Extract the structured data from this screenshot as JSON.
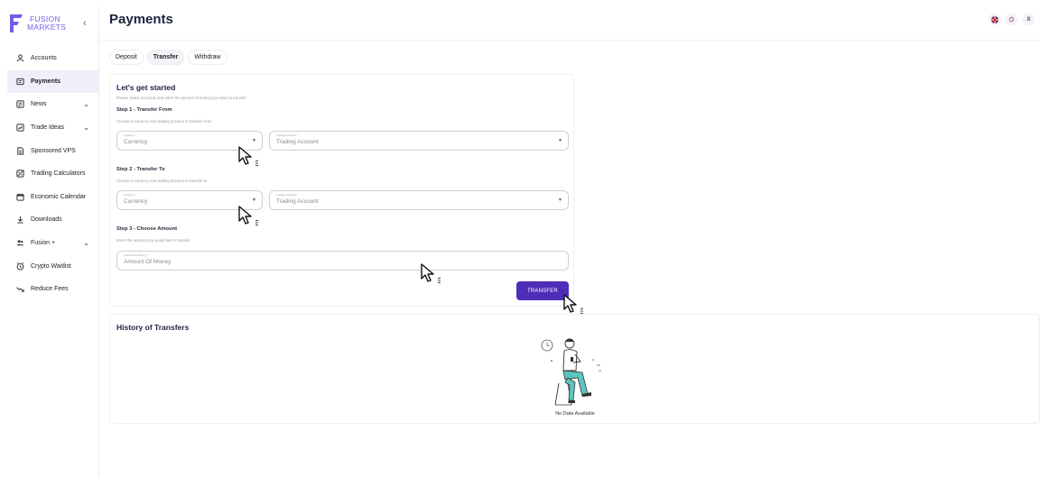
{
  "brand": {
    "line1": "FUSION",
    "line2": "MARKETS",
    "accent": "#7a5be8"
  },
  "sidebar": {
    "collapse_label": "‹",
    "items": [
      {
        "label": "Accounts",
        "icon": "accounts-icon",
        "chevron": false,
        "active": false
      },
      {
        "label": "Payments",
        "icon": "payments-icon",
        "chevron": false,
        "active": true
      },
      {
        "label": "News",
        "icon": "news-icon",
        "chevron": true,
        "active": false
      },
      {
        "label": "Trade Ideas",
        "icon": "trade-ideas-icon",
        "chevron": true,
        "active": false
      },
      {
        "label": "Sponsored VPS",
        "icon": "vps-icon",
        "chevron": false,
        "active": false
      },
      {
        "label": "Trading Calculators",
        "icon": "calculator-icon",
        "chevron": false,
        "active": false
      },
      {
        "label": "Economic Calendar",
        "icon": "calendar-icon",
        "chevron": false,
        "active": false
      },
      {
        "label": "Downloads",
        "icon": "download-icon",
        "chevron": false,
        "active": false
      },
      {
        "label": "Fusion +",
        "icon": "group-icon",
        "chevron": true,
        "active": false
      },
      {
        "label": "Crypto Waitlist",
        "icon": "clock-icon",
        "chevron": false,
        "active": false
      },
      {
        "label": "Reduce Fees",
        "icon": "trend-down-icon",
        "chevron": false,
        "active": false
      }
    ]
  },
  "header": {
    "title": "Payments",
    "icons": [
      "flag-uk-icon",
      "sync-icon",
      "close-icon"
    ],
    "close_label": "X"
  },
  "tabs": [
    {
      "label": "Deposit",
      "active": false
    },
    {
      "label": "Transfer",
      "active": true
    },
    {
      "label": "Withdraw",
      "active": false
    }
  ],
  "form": {
    "title": "Let's get started",
    "subtitle": "Please select accounts and enter the amount of money you want to transfer.",
    "step1": {
      "title": "Step 1 - Transfer From",
      "subtitle": "Choose a currency and trading account to transfer from.",
      "currency_label": "Currency *",
      "currency_value": "Currency",
      "account_label": "Trading Account *",
      "account_value": "Trading Account"
    },
    "step2": {
      "title": "Step 2 - Transfer To",
      "subtitle": "Choose a currency and trading account to transfer to.",
      "currency_label": "Currency *",
      "currency_value": "Currency",
      "account_label": "Trading Account *",
      "account_value": "Trading Account"
    },
    "step3": {
      "title": "Step 3 - Choose Amount",
      "subtitle": "Enter the amount you would like to transfer.",
      "amount_label": "Amount Of Money *",
      "amount_placeholder": "Amount Of Money"
    },
    "submit_label": "TRANSFER",
    "submit_color": "#4e2db8"
  },
  "history": {
    "title": "History of Transfers",
    "empty_text": "No Data Available"
  }
}
